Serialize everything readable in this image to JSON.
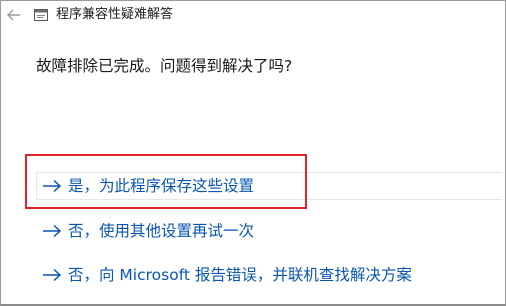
{
  "window": {
    "title": "程序兼容性疑难解答"
  },
  "icons": {
    "back": "back-arrow-icon",
    "app": "compatibility-troubleshooter-icon",
    "option_arrow": "right-arrow-icon"
  },
  "main": {
    "question": "故障排除已完成。问题得到解决了吗?",
    "options": [
      {
        "label": "是，为此程序保存这些设置"
      },
      {
        "label": "否，使用其他设置再试一次"
      },
      {
        "label": "否，向 Microsoft 报告错误，并联机查找解决方案"
      }
    ]
  },
  "colors": {
    "link": "#0a56b0",
    "highlight": "#e0242b"
  }
}
